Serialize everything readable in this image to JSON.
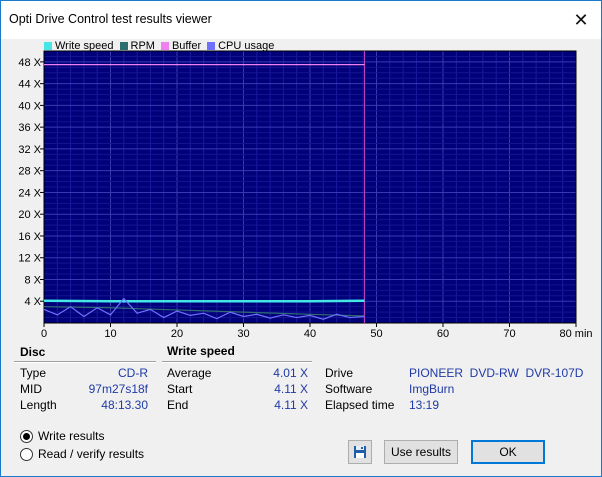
{
  "window": {
    "title": "Opti Drive Control test results viewer"
  },
  "legend": [
    {
      "label": "Write speed",
      "color": "#44e6e6"
    },
    {
      "label": "RPM",
      "color": "#2e6e6e"
    },
    {
      "label": "Buffer",
      "color": "#f080f0"
    },
    {
      "label": "CPU usage",
      "color": "#7070ff"
    }
  ],
  "chart_data": {
    "type": "line",
    "x_ticks": [
      "0",
      "10",
      "20",
      "30",
      "40",
      "50",
      "60",
      "70",
      "80 min"
    ],
    "y_ticks": [
      "4 X",
      "8 X",
      "12 X",
      "16 X",
      "20 X",
      "24 X",
      "28 X",
      "32 X",
      "36 X",
      "40 X",
      "44 X",
      "48 X"
    ],
    "xlim": [
      0,
      80
    ],
    "ylim": [
      0,
      50
    ],
    "background": "#00007a",
    "grid": true,
    "end_marker_x": 48.2,
    "series": [
      {
        "name": "Write speed",
        "color": "#44e6e6",
        "x": [
          0,
          10,
          20,
          30,
          40,
          48.2
        ],
        "y": [
          4.1,
          4.0,
          4.0,
          4.0,
          4.0,
          4.1
        ]
      },
      {
        "name": "RPM",
        "color": "#2e6e6e",
        "x": [
          0,
          10,
          20,
          30,
          40,
          48.2
        ],
        "y": [
          3.0,
          2.8,
          2.4,
          2.0,
          1.6,
          1.3
        ]
      },
      {
        "name": "Buffer",
        "color": "#f080f0",
        "x": [
          0,
          10,
          20,
          30,
          40,
          48.2
        ],
        "y": [
          47.5,
          47.5,
          47.5,
          47.5,
          47.5,
          47.5
        ]
      },
      {
        "name": "CPU usage",
        "color": "#7070ff",
        "x": [
          0,
          2,
          4,
          6,
          8,
          10,
          12,
          14,
          16,
          18,
          20,
          22,
          24,
          26,
          28,
          30,
          32,
          34,
          36,
          38,
          40,
          42,
          44,
          46,
          48.2
        ],
        "y": [
          2.5,
          1.5,
          3.0,
          1.2,
          2.8,
          1.5,
          4.5,
          1.8,
          2.5,
          1.0,
          2.2,
          1.4,
          1.8,
          0.8,
          2.0,
          1.2,
          1.6,
          0.9,
          1.5,
          1.0,
          1.4,
          0.7,
          1.6,
          1.0,
          1.2
        ]
      }
    ]
  },
  "disc": {
    "header": "Disc",
    "rows": [
      {
        "label": "Type",
        "value": "CD-R"
      },
      {
        "label": "MID",
        "value": "97m27s18f"
      },
      {
        "label": "Length",
        "value": "48:13.30"
      }
    ]
  },
  "write_speed": {
    "header": "Write speed",
    "rows": [
      {
        "label": "Average",
        "value": "4.01 X"
      },
      {
        "label": "Start",
        "value": "4.11 X"
      },
      {
        "label": "End",
        "value": "4.11 X"
      }
    ]
  },
  "info": {
    "rows": [
      {
        "label": "Drive",
        "value": "PIONEER  DVD-RW  DVR-107D"
      },
      {
        "label": "Software",
        "value": "ImgBurn"
      },
      {
        "label": "Elapsed time",
        "value": "13:19"
      }
    ]
  },
  "options": {
    "write_results": "Write results",
    "read_verify": "Read / verify results",
    "selected": "write_results"
  },
  "buttons": {
    "use_results": "Use results",
    "ok": "OK",
    "save_icon": "floppy-disk-icon"
  }
}
